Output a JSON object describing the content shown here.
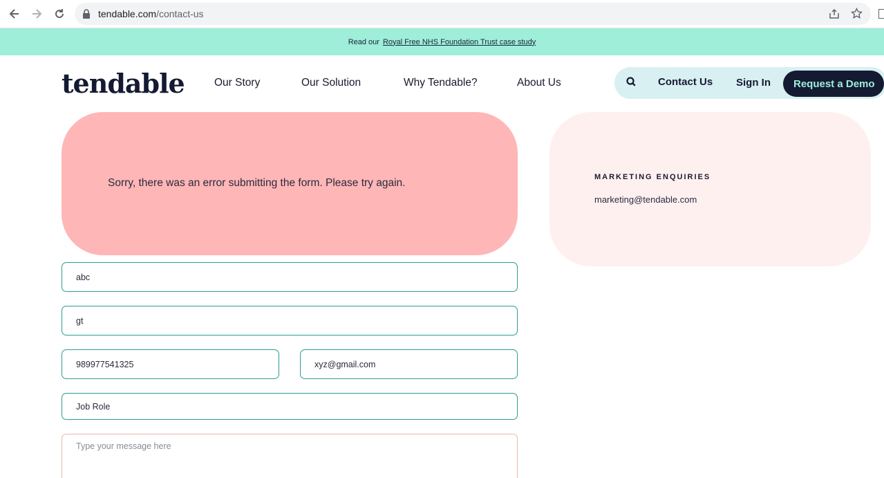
{
  "browser": {
    "url_domain": "tendable.com",
    "url_path": "/contact-us"
  },
  "announcement": {
    "prefix": "Read our",
    "link_text": "Royal Free NHS Foundation Trust case study"
  },
  "header": {
    "logo": "tendable",
    "menu": [
      "Our Story",
      "Our Solution",
      "Why Tendable?",
      "About Us"
    ],
    "contact": "Contact Us",
    "signin": "Sign In",
    "demo": "Request a Demo"
  },
  "error": {
    "message": "Sorry, there was an error submitting the form. Please try again."
  },
  "side": {
    "heading": "MARKETING ENQUIRIES",
    "email": "marketing@tendable.com"
  },
  "form": {
    "first_name": "abc",
    "last_name": "gt",
    "phone": "989977541325",
    "email": "xyz@gmail.com",
    "job_role_placeholder": "Job Role",
    "message_placeholder": "Type your message here"
  },
  "colors": {
    "accent_mint": "#9eeed9",
    "navy": "#151a33",
    "error_bg": "#ffb6b6",
    "teal_border": "#2a9d8f"
  }
}
